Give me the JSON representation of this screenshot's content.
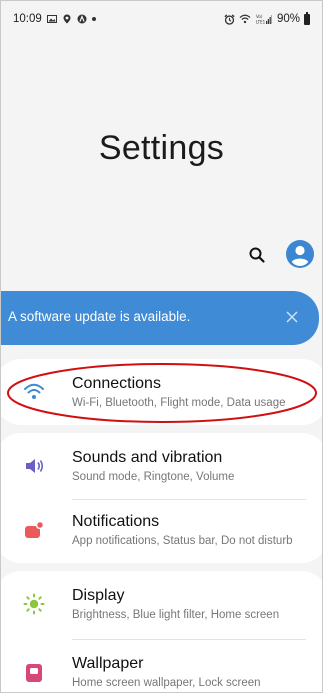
{
  "status_bar": {
    "time": "10:09",
    "battery": "90%",
    "icons_left": [
      "image-icon",
      "location-icon",
      "circle-a-icon",
      "dot-icon"
    ],
    "icons_right": [
      "alarm-icon",
      "wifi-icon",
      "volte-signal-icon",
      "battery-icon"
    ]
  },
  "header": {
    "title": "Settings"
  },
  "toolbar": {
    "search_icon": "search-icon",
    "account_icon": "account-icon"
  },
  "update_banner": {
    "text": "A software update is available.",
    "close_icon": "close-icon",
    "color": "#3f8bd6"
  },
  "items": [
    {
      "label": "Connections",
      "sub": "Wi-Fi, Bluetooth, Flight mode, Data usage",
      "icon": "wifi-icon",
      "color": "#3b8ad4",
      "highlighted": true
    },
    {
      "label": "Sounds and vibration",
      "sub": "Sound mode, Ringtone, Volume",
      "icon": "speaker-icon",
      "color": "#6a5fc4"
    },
    {
      "label": "Notifications",
      "sub": "App notifications, Status bar, Do not disturb",
      "icon": "notification-icon",
      "color": "#ea5a5a"
    },
    {
      "label": "Display",
      "sub": "Brightness, Blue light filter, Home screen",
      "icon": "sun-icon",
      "color": "#8cc63f"
    },
    {
      "label": "Wallpaper",
      "sub": "Home screen wallpaper, Lock screen",
      "icon": "wallpaper-icon",
      "color": "#d8477a"
    }
  ],
  "annotation": {
    "color": "#d01010"
  }
}
